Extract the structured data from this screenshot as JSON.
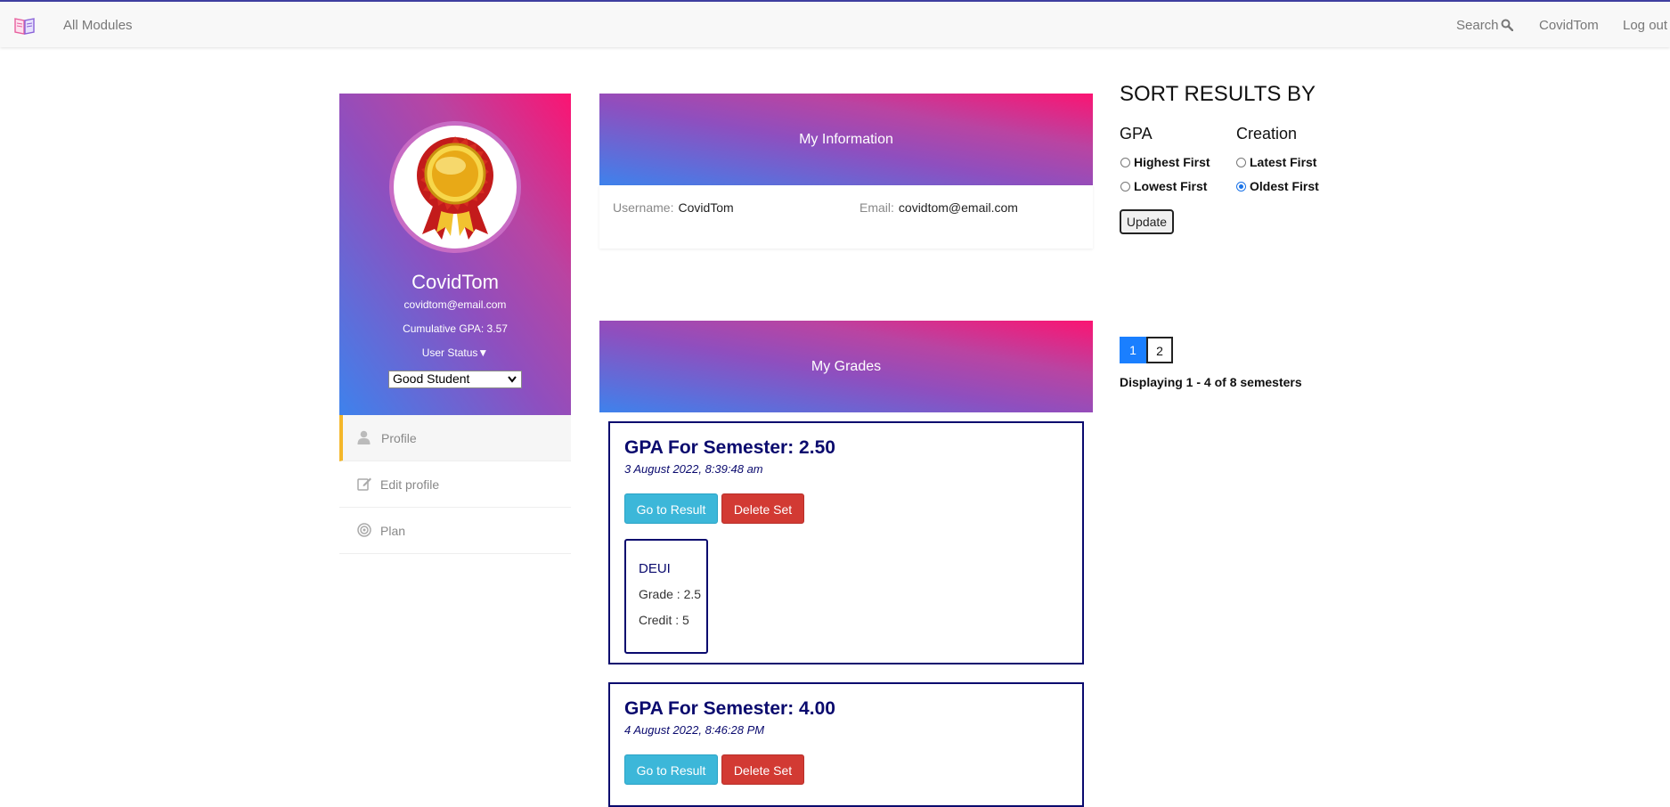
{
  "nav": {
    "all_modules": "All Modules",
    "search": "Search",
    "user": "CovidTom",
    "logout": "Log out"
  },
  "profile": {
    "name": "CovidTom",
    "email": "covidtom@email.com",
    "gpa": "Cumulative GPA: 3.57",
    "status_label": "User Status▼",
    "status_value": "Good Student"
  },
  "menu": [
    {
      "label": "Profile",
      "icon": "user-icon",
      "active": true
    },
    {
      "label": "Edit profile",
      "icon": "edit-icon",
      "active": false
    },
    {
      "label": "Plan",
      "icon": "target-icon",
      "active": false
    }
  ],
  "info": {
    "title": "My Information",
    "username_label": "Username:",
    "username": "CovidTom",
    "email_label": "Email:",
    "email": "covidtom@email.com"
  },
  "grades": {
    "title": "My Grades",
    "go_label": "Go to Result",
    "delete_label": "Delete Set",
    "semesters": [
      {
        "title": "GPA For Semester: 2.50",
        "date": "3 August 2022, 8:39:48 am",
        "courses": [
          {
            "name": "DEUI",
            "grade": "Grade : 2.5",
            "credit": "Credit : 5"
          }
        ]
      },
      {
        "title": "GPA For Semester: 4.00",
        "date": "4 August 2022, 8:46:28 PM",
        "courses": []
      }
    ]
  },
  "sort": {
    "title": "SORT RESULTS BY",
    "gpa_head": "GPA",
    "creation_head": "Creation",
    "highest": "Highest First",
    "lowest": "Lowest First",
    "latest": "Latest First",
    "oldest": "Oldest First",
    "selected": "Oldest First",
    "update": "Update"
  },
  "pagination": {
    "pages": [
      "1",
      "2"
    ],
    "current": "1",
    "info": "Displaying 1 - 4 of 8 semesters"
  },
  "colors": {
    "nav_border": "#3f3fa0",
    "gradient_start": "#3e82ec",
    "gradient_end": "#fb1472",
    "semester_text": "#0a0a6e",
    "result_button": "#3cb7d9",
    "delete_button": "#d23a33",
    "active_menu_bar": "#f4b72a",
    "active_page": "#1a7fff"
  }
}
